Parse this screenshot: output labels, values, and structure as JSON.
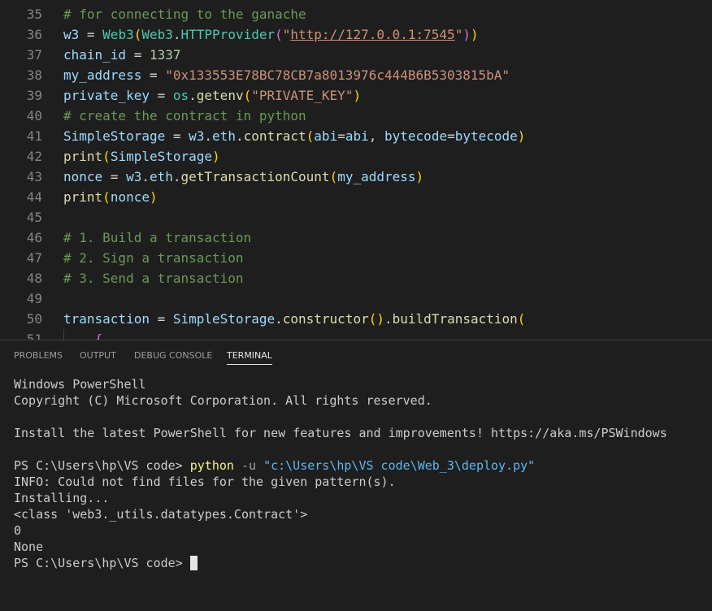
{
  "editor": {
    "lines": [
      {
        "num": "35",
        "parts": [
          {
            "t": "# for connecting to the ganache",
            "c": "comment"
          }
        ]
      },
      {
        "num": "36",
        "parts": [
          {
            "t": "w3",
            "c": "var"
          },
          {
            "t": " = ",
            "c": "op"
          },
          {
            "t": "Web3",
            "c": "class"
          },
          {
            "t": "(",
            "c": "b1"
          },
          {
            "t": "Web3",
            "c": "class"
          },
          {
            "t": ".",
            "c": "op"
          },
          {
            "t": "HTTPProvider",
            "c": "class"
          },
          {
            "t": "(",
            "c": "b2"
          },
          {
            "t": "\"",
            "c": "str"
          },
          {
            "t": "http://127.0.0.1:7545",
            "c": "url"
          },
          {
            "t": "\"",
            "c": "str"
          },
          {
            "t": ")",
            "c": "b2"
          },
          {
            "t": ")",
            "c": "b1"
          }
        ]
      },
      {
        "num": "37",
        "parts": [
          {
            "t": "chain_id",
            "c": "var"
          },
          {
            "t": " = ",
            "c": "op"
          },
          {
            "t": "1337",
            "c": "num"
          }
        ]
      },
      {
        "num": "38",
        "parts": [
          {
            "t": "my_address",
            "c": "var"
          },
          {
            "t": " = ",
            "c": "op"
          },
          {
            "t": "\"0x133553E78BC78CB7a8013976c444B6B5303815bA\"",
            "c": "str"
          }
        ]
      },
      {
        "num": "39",
        "parts": [
          {
            "t": "private_key",
            "c": "var"
          },
          {
            "t": " = ",
            "c": "op"
          },
          {
            "t": "os",
            "c": "class"
          },
          {
            "t": ".",
            "c": "op"
          },
          {
            "t": "getenv",
            "c": "func"
          },
          {
            "t": "(",
            "c": "b1"
          },
          {
            "t": "\"PRIVATE_KEY\"",
            "c": "str"
          },
          {
            "t": ")",
            "c": "b1"
          }
        ]
      },
      {
        "num": "40",
        "parts": [
          {
            "t": "# create the contract in python",
            "c": "comment"
          }
        ]
      },
      {
        "num": "41",
        "parts": [
          {
            "t": "SimpleStorage",
            "c": "var"
          },
          {
            "t": " = ",
            "c": "op"
          },
          {
            "t": "w3",
            "c": "var"
          },
          {
            "t": ".",
            "c": "op"
          },
          {
            "t": "eth",
            "c": "var"
          },
          {
            "t": ".",
            "c": "op"
          },
          {
            "t": "contract",
            "c": "func"
          },
          {
            "t": "(",
            "c": "b1"
          },
          {
            "t": "abi",
            "c": "var"
          },
          {
            "t": "=",
            "c": "op"
          },
          {
            "t": "abi",
            "c": "var"
          },
          {
            "t": ", ",
            "c": "op"
          },
          {
            "t": "bytecode",
            "c": "var"
          },
          {
            "t": "=",
            "c": "op"
          },
          {
            "t": "bytecode",
            "c": "var"
          },
          {
            "t": ")",
            "c": "b1"
          }
        ]
      },
      {
        "num": "42",
        "parts": [
          {
            "t": "print",
            "c": "func"
          },
          {
            "t": "(",
            "c": "b1"
          },
          {
            "t": "SimpleStorage",
            "c": "var"
          },
          {
            "t": ")",
            "c": "b1"
          }
        ]
      },
      {
        "num": "43",
        "parts": [
          {
            "t": "nonce",
            "c": "var"
          },
          {
            "t": " = ",
            "c": "op"
          },
          {
            "t": "w3",
            "c": "var"
          },
          {
            "t": ".",
            "c": "op"
          },
          {
            "t": "eth",
            "c": "var"
          },
          {
            "t": ".",
            "c": "op"
          },
          {
            "t": "getTransactionCount",
            "c": "func"
          },
          {
            "t": "(",
            "c": "b1"
          },
          {
            "t": "my_address",
            "c": "var"
          },
          {
            "t": ")",
            "c": "b1"
          }
        ]
      },
      {
        "num": "44",
        "parts": [
          {
            "t": "print",
            "c": "func"
          },
          {
            "t": "(",
            "c": "b1"
          },
          {
            "t": "nonce",
            "c": "var"
          },
          {
            "t": ")",
            "c": "b1"
          }
        ]
      },
      {
        "num": "45",
        "parts": []
      },
      {
        "num": "46",
        "parts": [
          {
            "t": "# 1. Build a transaction",
            "c": "comment"
          }
        ]
      },
      {
        "num": "47",
        "parts": [
          {
            "t": "# 2. Sign a transaction",
            "c": "comment"
          }
        ]
      },
      {
        "num": "48",
        "parts": [
          {
            "t": "# 3. Send a transaction",
            "c": "comment"
          }
        ]
      },
      {
        "num": "49",
        "parts": []
      },
      {
        "num": "50",
        "parts": [
          {
            "t": "transaction",
            "c": "var"
          },
          {
            "t": " = ",
            "c": "op"
          },
          {
            "t": "SimpleStorage",
            "c": "var"
          },
          {
            "t": ".",
            "c": "op"
          },
          {
            "t": "constructor",
            "c": "func"
          },
          {
            "t": "(",
            "c": "b1"
          },
          {
            "t": ")",
            "c": "b1"
          },
          {
            "t": ".",
            "c": "op"
          },
          {
            "t": "buildTransaction",
            "c": "func"
          },
          {
            "t": "(",
            "c": "b1"
          }
        ]
      },
      {
        "num": "51",
        "parts": [
          {
            "t": "    {",
            "c": "b2"
          }
        ]
      }
    ]
  },
  "panel": {
    "tabs": [
      {
        "label": "PROBLEMS",
        "active": false
      },
      {
        "label": "OUTPUT",
        "active": false
      },
      {
        "label": "DEBUG CONSOLE",
        "active": false
      },
      {
        "label": "TERMINAL",
        "active": true
      }
    ]
  },
  "terminal": {
    "header1": "Windows PowerShell",
    "header2": "Copyright (C) Microsoft Corporation. All rights reserved.",
    "install_msg": "Install the latest PowerShell for new features and improvements! https://aka.ms/PSWindows",
    "prompt1": "PS C:\\Users\\hp\\VS code> ",
    "cmd": "python",
    "flag": " -u ",
    "arg": "\"c:\\Users\\hp\\VS code\\Web_3\\deploy.py\"",
    "out1": "INFO: Could not find files for the given pattern(s).",
    "out2": "Installing...",
    "out3": "<class 'web3._utils.datatypes.Contract'>",
    "out4": "0",
    "out5": "None",
    "prompt2": "PS C:\\Users\\hp\\VS code> "
  },
  "colors": {
    "comment": "#6a9955",
    "string": "#ce9178",
    "variable": "#9cdcfe",
    "function": "#dcdcaa",
    "class": "#4ec9b0",
    "number": "#b5cea8",
    "terminal_command": "#f1f18b",
    "terminal_string": "#5fb6f0"
  }
}
